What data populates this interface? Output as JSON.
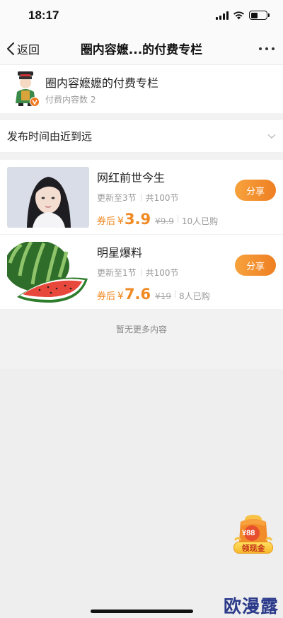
{
  "status_bar": {
    "time": "18:17"
  },
  "nav": {
    "back_label": "返回",
    "title": "圈内容嬷...的付费专栏"
  },
  "column": {
    "name": "圈内容嬷嬷的付费专栏",
    "count_text": "付费内容数 2"
  },
  "sort": {
    "label": "发布时间由近到远"
  },
  "items": [
    {
      "title": "网红前世今生",
      "updated": "更新至3节",
      "total": "共100节",
      "price_prefix": "券后",
      "currency": "¥",
      "price": "3.9",
      "old_price": "¥9.9",
      "sold": "10人已购",
      "share_label": "分享"
    },
    {
      "title": "明星爆料",
      "updated": "更新至1节",
      "total": "共100节",
      "price_prefix": "券后",
      "currency": "¥",
      "price": "7.6",
      "old_price": "¥19",
      "sold": "8人已购",
      "share_label": "分享"
    }
  ],
  "footer": {
    "no_more": "暂无更多内容"
  },
  "coupon": {
    "amount": "¥88",
    "label": "领现金"
  },
  "watermark": "欧漫露",
  "colors": {
    "accent": "#f08a24",
    "share_button": "#ee7f22"
  }
}
